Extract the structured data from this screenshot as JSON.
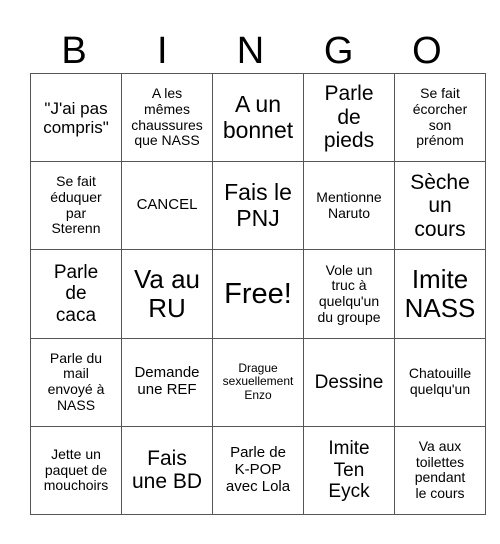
{
  "header": [
    "B",
    "I",
    "N",
    "G",
    "O"
  ],
  "cells": [
    [
      "\"J'ai pas\ncompris\"",
      "A les\nmêmes\nchaussures\nque NASS",
      "A un\nbonnet",
      "Parle\nde\npieds",
      "Se fait\nécorcher\nson\nprénom"
    ],
    [
      "Se fait\néduquer\npar\nSterenn",
      "CANCEL",
      "Fais le\nPNJ",
      "Mentionne\nNaruto",
      "Sèche\nun\ncours"
    ],
    [
      "Parle\nde\ncaca",
      "Va au\nRU",
      "Free!",
      "Vole un\ntruc à\nquelqu'un\ndu groupe",
      "Imite\nNASS"
    ],
    [
      "Parle du\nmail\nenvoyé à\nNASS",
      "Demande\nune REF",
      "Drague\nsexuellement\nEnzo",
      "Dessine",
      "Chatouille\nquelqu'un"
    ],
    [
      "Jette un\npaquet de\nmouchoirs",
      "Fais\nune BD",
      "Parle de\nK-POP\navec Lola",
      "Imite\nTen\nEyck",
      "Va aux\ntoilettes\npendant\nle cours"
    ]
  ]
}
